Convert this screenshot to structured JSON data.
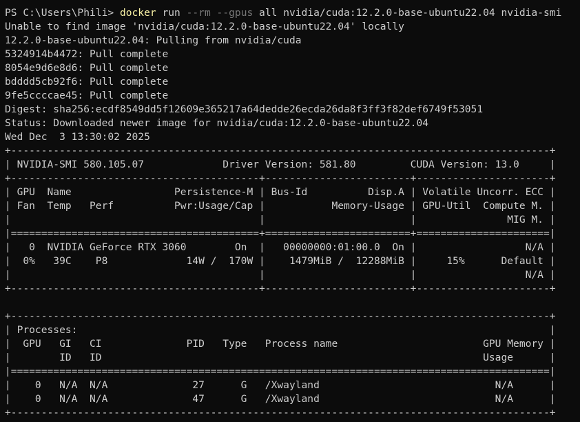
{
  "window": {
    "background": "#0c0c0c",
    "foreground": "#cccccc",
    "command_color": "#f9f1a5",
    "flag_color": "#767676"
  },
  "prompt": {
    "text": "PS C:\\Users\\Phili> ",
    "command": "docker",
    "arg1": " run ",
    "flag1": "--rm",
    "space1": " ",
    "flag2": "--gpus",
    "rest": " all nvidia/cuda:12.2.0-base-ubuntu22.04 nvidia-smi"
  },
  "output_lines": [
    "Unable to find image 'nvidia/cuda:12.2.0-base-ubuntu22.04' locally",
    "12.2.0-base-ubuntu22.04: Pulling from nvidia/cuda",
    "5324914b4472: Pull complete",
    "8054e9d6e8d6: Pull complete",
    "bdddd5cb92f6: Pull complete",
    "9fe5ccccae45: Pull complete",
    "Digest: sha256:ecdf8549dd5f12609e365217a64dedde26ecda26da8f3ff3f82def6749f53051",
    "Status: Downloaded newer image for nvidia/cuda:12.2.0-base-ubuntu22.04",
    "Wed Dec  3 13:30:02 2025",
    "+-----------------------------------------------------------------------------------------+",
    "| NVIDIA-SMI 580.105.07             Driver Version: 581.80         CUDA Version: 13.0     |",
    "+-----------------------------------------+------------------------+----------------------+",
    "| GPU  Name                 Persistence-M | Bus-Id          Disp.A | Volatile Uncorr. ECC |",
    "| Fan  Temp   Perf          Pwr:Usage/Cap |           Memory-Usage | GPU-Util  Compute M. |",
    "|                                         |                        |               MIG M. |",
    "|=========================================+========================+======================|",
    "|   0  NVIDIA GeForce RTX 3060        On  |   00000000:01:00.0  On |                  N/A |",
    "|  0%   39C    P8             14W /  170W |    1479MiB /  12288MiB |     15%      Default |",
    "|                                         |                        |                  N/A |",
    "+-----------------------------------------+------------------------+----------------------+",
    "",
    "+-----------------------------------------------------------------------------------------+",
    "| Processes:                                                                              |",
    "|  GPU   GI   CI              PID   Type   Process name                        GPU Memory |",
    "|        ID   ID                                                               Usage      |",
    "|=========================================================================================|",
    "|    0   N/A  N/A              27      G   /Xwayland                             N/A      |",
    "|    0   N/A  N/A              47      G   /Xwayland                             N/A      |",
    "+-----------------------------------------------------------------------------------------+"
  ]
}
